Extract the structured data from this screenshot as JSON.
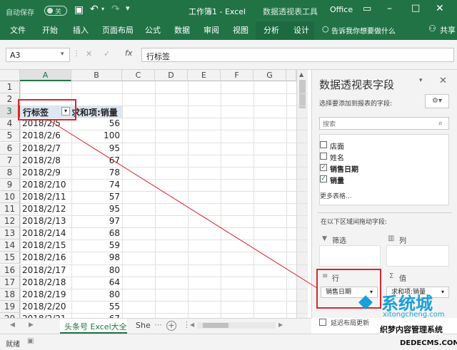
{
  "title_bar": {
    "autosave_label": "自动保存",
    "autosave_state": "关",
    "doc_title": "工作簿1 - Excel",
    "context_title": "数据透视表工具",
    "office_label": "Office"
  },
  "ribbon": {
    "tabs": [
      "文件",
      "开始",
      "插入",
      "页面布局",
      "公式",
      "数据",
      "审阅",
      "视图",
      "分析",
      "设计"
    ],
    "tell_me": "告诉我你想要做什么",
    "share": "共享"
  },
  "formula_bar": {
    "name_box": "A3",
    "fx": "fx",
    "content": "行标签"
  },
  "grid": {
    "columns": [
      "A",
      "B",
      "C",
      "D",
      "E",
      "F",
      "G"
    ],
    "rows": [
      "1",
      "2",
      "3",
      "4",
      "5",
      "6",
      "7",
      "8",
      "9",
      "10",
      "11",
      "12",
      "13",
      "14",
      "15",
      "16",
      "17",
      "18",
      "19",
      "20"
    ],
    "header_a": "行标签",
    "header_b": "求和项:销量",
    "data": [
      {
        "date": "2018/2/5",
        "qty": "56"
      },
      {
        "date": "2018/2/6",
        "qty": "100"
      },
      {
        "date": "2018/2/7",
        "qty": "95"
      },
      {
        "date": "2018/2/8",
        "qty": "67"
      },
      {
        "date": "2018/2/9",
        "qty": "78"
      },
      {
        "date": "2018/2/10",
        "qty": "74"
      },
      {
        "date": "2018/2/11",
        "qty": "57"
      },
      {
        "date": "2018/2/12",
        "qty": "95"
      },
      {
        "date": "2018/2/13",
        "qty": "97"
      },
      {
        "date": "2018/2/14",
        "qty": "68"
      },
      {
        "date": "2018/2/15",
        "qty": "59"
      },
      {
        "date": "2018/2/16",
        "qty": "98"
      },
      {
        "date": "2018/2/17",
        "qty": "80"
      },
      {
        "date": "2018/2/18",
        "qty": "64"
      },
      {
        "date": "2018/2/19",
        "qty": "80"
      },
      {
        "date": "2018/2/20",
        "qty": "55"
      },
      {
        "date": "2018/2/21",
        "qty": "67"
      }
    ]
  },
  "pivot_pane": {
    "title": "数据透视表字段",
    "subtitle": "选择要添加到报表的字段:",
    "search_placeholder": "搜索",
    "fields": [
      {
        "name": "店面",
        "checked": false
      },
      {
        "name": "姓名",
        "checked": false
      },
      {
        "name": "销售日期",
        "checked": true
      },
      {
        "name": "销量",
        "checked": true
      }
    ],
    "more_tables": "更多表格...",
    "drag_hint": "在以下区域间拖动字段:",
    "filters_label": "筛选",
    "columns_label": "列",
    "rows_label": "行",
    "values_label": "值",
    "rows_item": "销售日期",
    "values_item": "求和项:销量",
    "defer_label": "延迟布局更新"
  },
  "sheet_tabs": {
    "active": "头条号 Excel大全",
    "other": "She",
    "add": "+"
  },
  "status": {
    "ready": "就绪"
  },
  "watermark": {
    "line1": "系统城",
    "line2": "xitongcheng.com",
    "line3": "织梦内容管理系统",
    "line4": "DEDECMS.COM"
  }
}
